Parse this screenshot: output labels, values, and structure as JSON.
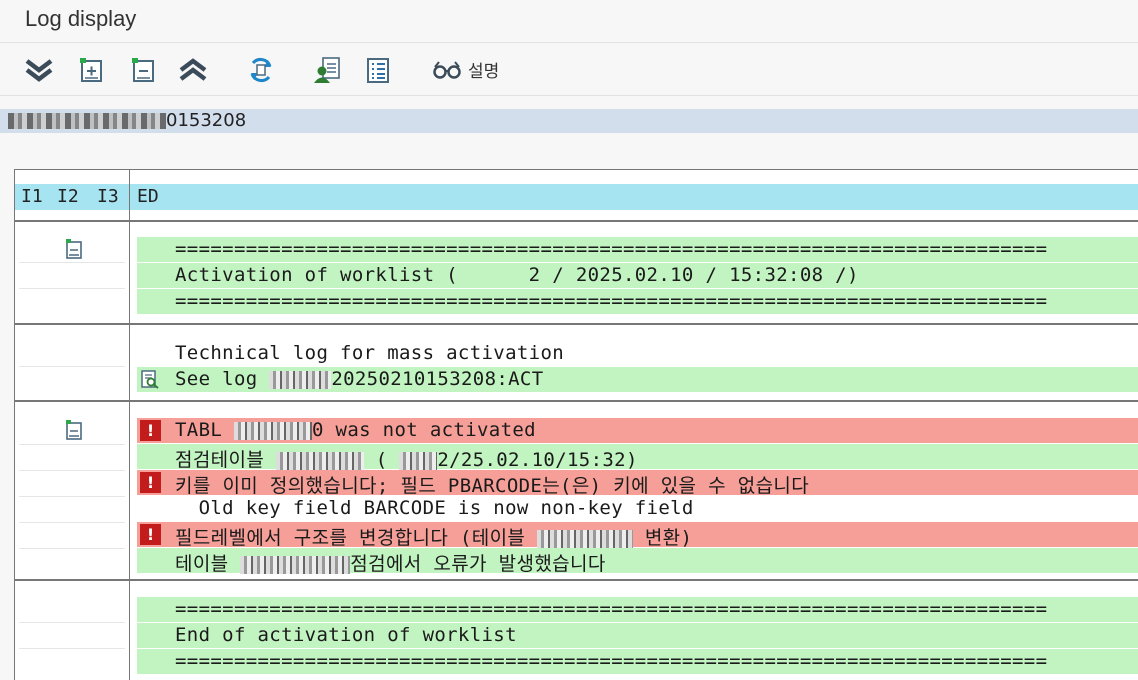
{
  "window": {
    "title": "Log display"
  },
  "toolbar": {
    "buttons": [
      {
        "name": "expand-all-icon"
      },
      {
        "name": "expand-icon"
      },
      {
        "name": "collapse-icon"
      },
      {
        "name": "collapse-all-icon"
      },
      {
        "name": "refresh-icon"
      },
      {
        "name": "user-details-icon"
      },
      {
        "name": "list-icon"
      }
    ],
    "explain_label": "설명"
  },
  "header": {
    "suffix": "0153208"
  },
  "table": {
    "columns": [
      "I1",
      "I2",
      "I3",
      "ED"
    ],
    "sections": [
      {
        "lines": [
          {
            "type": "green",
            "text": "=========================================================================="
          },
          {
            "type": "green",
            "text": "Activation of worklist (      2 / 2025.02.10 / 15:32:08 /)"
          },
          {
            "type": "green",
            "text": "=========================================================================="
          }
        ]
      },
      {
        "lines": [
          {
            "type": "white",
            "text": "Technical log for mass activation"
          },
          {
            "type": "green",
            "icon": "details",
            "text_pre": "See log ",
            "text": "20250210153208:ACT"
          }
        ]
      },
      {
        "lines": [
          {
            "type": "red",
            "icon": "error",
            "text_pre": "TABL ",
            "text": "0 was not activated"
          },
          {
            "type": "green",
            "text_pre": "점검테이블 ",
            "text": "2/25.02.10/15:32)"
          },
          {
            "type": "red",
            "icon": "error",
            "text": "키를 이미 정의했습니다; 필드 PBARCODE는(은) 키에 있을 수 없습니다"
          },
          {
            "type": "white",
            "text": "  Old key field BARCODE is now non-key field"
          },
          {
            "type": "red",
            "icon": "error",
            "text_pre": "필드레벨에서 구조를 변경합니다 (테이블 ",
            "text": " 변환)"
          },
          {
            "type": "green",
            "text_pre": "테이블 ",
            "text": "점검에서 오류가 발생했습니다"
          }
        ]
      },
      {
        "lines": [
          {
            "type": "green",
            "text": "=========================================================================="
          },
          {
            "type": "green",
            "text": "End of activation of worklist"
          },
          {
            "type": "green",
            "text": "=========================================================================="
          }
        ]
      }
    ]
  },
  "colors": {
    "ok": "#c2f4c2",
    "error": "#f59f98",
    "header": "#a6e4f2"
  }
}
